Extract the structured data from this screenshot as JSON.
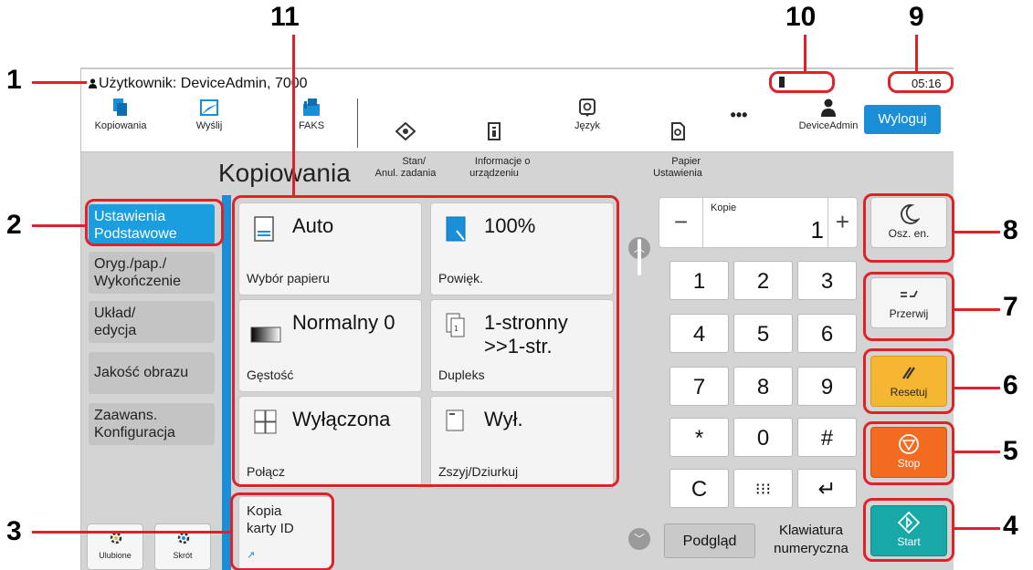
{
  "callouts": [
    "1",
    "2",
    "3",
    "4",
    "5",
    "6",
    "7",
    "8",
    "9",
    "10",
    "11"
  ],
  "status_bar": {
    "user_text": "Użytkownik: DeviceAdmin, 7000",
    "clock": "05:16"
  },
  "toolbar": {
    "items": [
      {
        "label": "Kopiowania",
        "icon": "copy-icon"
      },
      {
        "label": "Wyślij",
        "icon": "send-icon"
      },
      {
        "label": "FAKS",
        "icon": "fax-icon"
      },
      {
        "label": "Stan/\nAnul. zadania",
        "icon": "status-icon"
      },
      {
        "label": "Informacje o\nurządzeniu",
        "icon": "device-info-icon"
      },
      {
        "label": "Język",
        "icon": "language-icon"
      },
      {
        "label": "Papier\nUstawienia",
        "icon": "paper-settings-icon"
      },
      {
        "label": "•••",
        "icon": "more-icon"
      },
      {
        "label": "DeviceAdmin",
        "icon": "user-icon"
      }
    ],
    "logout_label": "Wyloguj"
  },
  "page_title": "Kopiowania",
  "nav": {
    "items": [
      {
        "label": "Ustawienia\nPodstawowe",
        "active": true
      },
      {
        "label": "Oryg./pap./\nWykończenie",
        "active": false
      },
      {
        "label": "Układ/\nedycja",
        "active": false
      },
      {
        "label": "Jakość obrazu",
        "active": false
      },
      {
        "label": "Zaawans.\nKonfiguracja",
        "active": false
      }
    ],
    "favorites_label": "Ulubione",
    "shortcut_label": "Skrót"
  },
  "tiles": [
    {
      "value": "Auto",
      "label": "Wybór papieru",
      "icon": "paper-select-icon"
    },
    {
      "value": "100%",
      "label": "Powięk.",
      "icon": "zoom-icon"
    },
    {
      "value": "Normalny 0",
      "label": "Gęstość",
      "icon": "density-icon"
    },
    {
      "value": "1-stronny\n>>1-str.",
      "label": "Dupleks",
      "icon": "duplex-icon"
    },
    {
      "value": "Wyłączona",
      "label": "Połącz",
      "icon": "combine-icon"
    },
    {
      "value": "Wył.",
      "label": "Zszyj/Dziurkuj",
      "icon": "staple-icon"
    }
  ],
  "id_copy": {
    "label": "Kopia\nkarty ID"
  },
  "copies": {
    "label": "Kopie",
    "value": "1",
    "minus": "−",
    "plus": "+"
  },
  "keypad": [
    "1",
    "2",
    "3",
    "4",
    "5",
    "6",
    "7",
    "8",
    "9",
    "*",
    "0",
    "#",
    "C",
    "⁝⁝⁝",
    "↵"
  ],
  "preview_label": "Podgląd",
  "numeric_keyboard_label": "Klawiatura\nnumeryczna",
  "side_buttons": {
    "energy_saver": "Osz. en.",
    "interrupt": "Przerwij",
    "reset": "Resetuj",
    "stop": "Stop",
    "start": "Start"
  },
  "colors": {
    "callout": "#e02128",
    "accent_blue": "#1a8fd8",
    "reset": "#f5b631",
    "stop": "#f26b21",
    "start": "#18a8a8"
  }
}
